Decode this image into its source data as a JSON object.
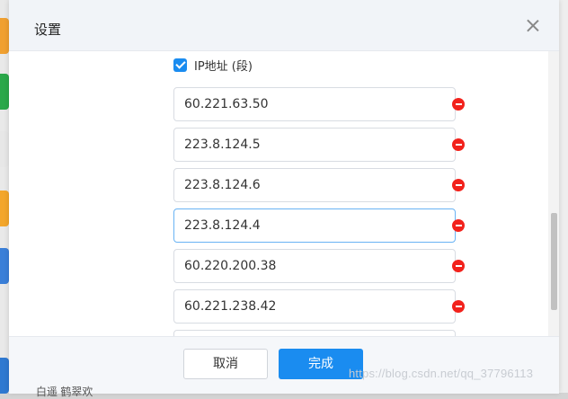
{
  "dialog": {
    "title": "设置",
    "ip_checkbox": {
      "label": "IP地址 (段)",
      "checked": true
    },
    "ip_list": [
      {
        "value": "60.221.63.50",
        "focused": false
      },
      {
        "value": "223.8.124.5",
        "focused": false
      },
      {
        "value": "223.8.124.6",
        "focused": false
      },
      {
        "value": "223.8.124.4",
        "focused": true
      },
      {
        "value": "60.220.200.38",
        "focused": false
      },
      {
        "value": "60.221.238.42",
        "focused": false
      },
      {
        "value": "",
        "focused": false
      }
    ],
    "cancel_label": "取消",
    "confirm_label": "完成"
  },
  "background": {
    "bottom_text": "白遥    鹤翠欢"
  },
  "watermark": "https://blog.csdn.net/qq_37796113",
  "colors": {
    "accent": "#1a8cf0",
    "remove": "#f2221c",
    "header_bg": "#f1f4f8"
  }
}
